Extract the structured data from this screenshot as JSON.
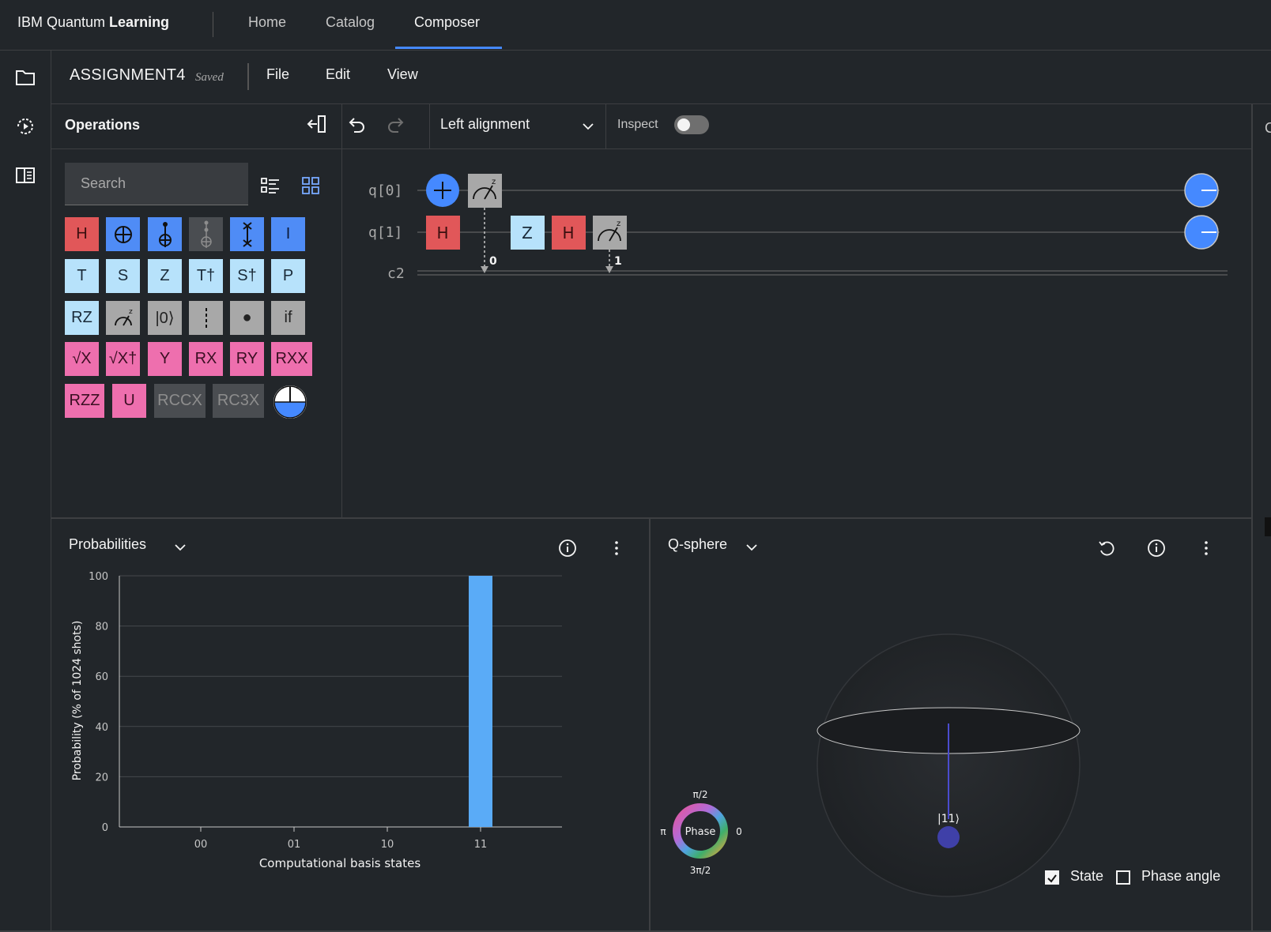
{
  "brand": {
    "prefix": "IBM Quantum ",
    "bold": "Learning"
  },
  "nav": [
    {
      "label": "Home"
    },
    {
      "label": "Catalog"
    },
    {
      "label": "Composer",
      "active": true
    }
  ],
  "rail": [
    {
      "icon": "folder-icon"
    },
    {
      "icon": "run-history-icon"
    },
    {
      "icon": "side-panel-icon"
    }
  ],
  "file": {
    "name": "ASSIGNMENT4",
    "status": "Saved",
    "menus": [
      "File",
      "Edit",
      "View"
    ]
  },
  "operations": {
    "title": "Operations",
    "search_placeholder": "Search",
    "gates": [
      [
        "H",
        "⊕",
        "ccx",
        "ccx-dim",
        "swap",
        "I"
      ],
      [
        "T",
        "S",
        "Z",
        "T†",
        "S†",
        "P"
      ],
      [
        "RZ",
        "measure",
        "|0⟩",
        "barrier",
        "●",
        "if"
      ],
      [
        "√X",
        "√X†",
        "Y",
        "RX",
        "RY",
        "RXX"
      ],
      [
        "RZZ",
        "U",
        "RCCX",
        "RC3X",
        "custom"
      ]
    ]
  },
  "toolbar": {
    "alignment": "Left alignment",
    "inspect_label": "Inspect",
    "inspect_on": false
  },
  "circuit": {
    "qubits": [
      "q[0]",
      "q[1]"
    ],
    "classical": "c2",
    "q0_gates": [
      "+",
      "measure"
    ],
    "q1_gates": [
      "H",
      "Z",
      "H",
      "measure"
    ],
    "measure_bits": [
      "0",
      "1"
    ]
  },
  "probabilities": {
    "title": "Probabilities",
    "chart_data": {
      "type": "bar",
      "categories": [
        "00",
        "01",
        "10",
        "11"
      ],
      "values": [
        0,
        0,
        0,
        100
      ],
      "xlabel": "Computational basis states",
      "ylabel": "Probability (% of 1024 shots)",
      "ylim": [
        0,
        100
      ],
      "yticks": [
        "0",
        "20",
        "40",
        "60",
        "80",
        "100"
      ],
      "grid": true,
      "bar_color": "#5aabf7"
    }
  },
  "qsphere": {
    "title": "Q-sphere",
    "state_label": "|11⟩",
    "phase": {
      "center": "Phase",
      "top": "π/2",
      "left": "π",
      "right": "0",
      "bottom": "3π/2"
    },
    "checkboxes": [
      {
        "label": "State",
        "checked": true
      },
      {
        "label": "Phase angle",
        "checked": false
      }
    ]
  },
  "right_strip_letter": "C",
  "colors": {
    "accent": "#4589ff",
    "background": "#22262a",
    "bar": "#5aabf7",
    "state_dot": "#3f40a8"
  }
}
